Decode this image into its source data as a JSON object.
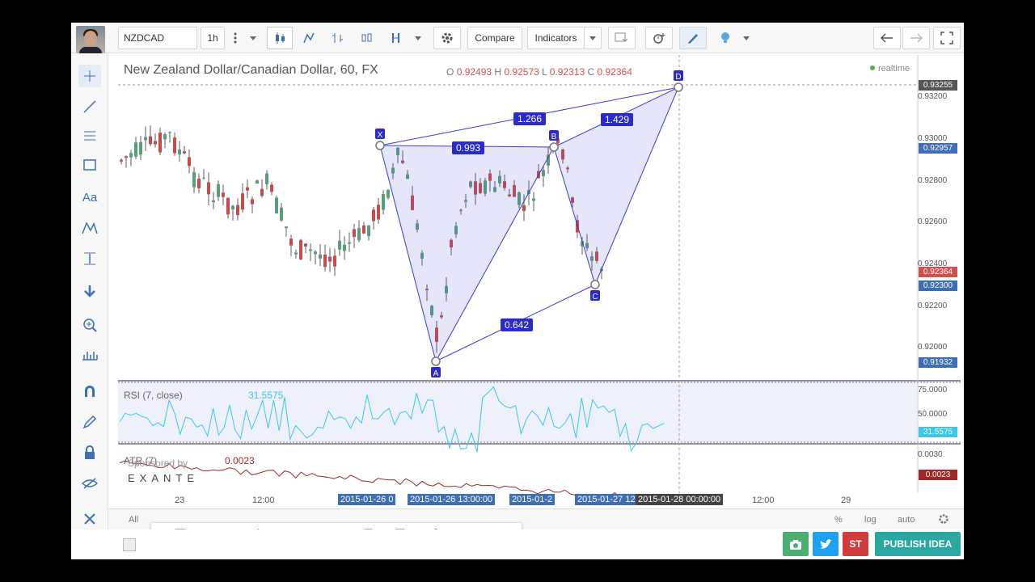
{
  "toolbar": {
    "symbol": "NZDCAD",
    "interval": "1h",
    "compare_label": "Compare",
    "indicators_label": "Indicators"
  },
  "chart": {
    "title": "New Zealand Dollar/Canadian Dollar, 60, FX",
    "ohlc": {
      "o_label": "O",
      "o": "0.92493",
      "h_label": "H",
      "h": "0.92573",
      "l_label": "L",
      "l": "0.92313",
      "c_label": "C",
      "c": "0.92364"
    },
    "realtime": "realtime",
    "price_axis": [
      "0.93200",
      "0.93000",
      "0.92800",
      "0.92600",
      "0.92400",
      "0.92200",
      "0.92000"
    ],
    "price_tags": [
      {
        "label": "0.93255",
        "color": "#555555"
      },
      {
        "label": "0.92957",
        "color": "#3e6fb5"
      },
      {
        "label": "0.92364",
        "color": "#d05050"
      },
      {
        "label": "0.92300",
        "color": "#3e6fb5"
      },
      {
        "label": "0.91932",
        "color": "#3e6fb5"
      }
    ],
    "pattern_points": [
      "X",
      "A",
      "B",
      "C",
      "D"
    ],
    "pattern_ratios": [
      "1.266",
      "1.429",
      "0.993",
      "0.642"
    ],
    "pattern_color": "#2a2ad0"
  },
  "rsi": {
    "label": "RSI (7, close)",
    "value": "31.5575",
    "axis": [
      "75.0000",
      "50.0000"
    ],
    "tag": "31.5575"
  },
  "atr": {
    "label": "ATR (7)",
    "value": "0.0023",
    "axis": [
      "0.0030"
    ],
    "tag": "0.0023"
  },
  "sponsor": {
    "text": "Sponsored by",
    "brand": "EXANTE"
  },
  "time_axis": {
    "labels": [
      "23",
      "12:00",
      "12:00",
      "29"
    ],
    "highlighted": [
      "2015-01-26 0",
      "2015-01-26 13:00:00",
      "2015-01-2",
      "2015-01-27 12:00:00"
    ],
    "cursor": "2015-01-28 00:00:00"
  },
  "bottombar": {
    "all": "All",
    "percent": "%",
    "log": "log",
    "auto": "auto"
  },
  "footer": {
    "publish": "PUBLISH IDEA",
    "st": "ST"
  },
  "colors": {
    "accent": "#3e6fb5",
    "up": "#5a9e7a",
    "down": "#c84b4b",
    "publish": "#2aa7a0"
  }
}
